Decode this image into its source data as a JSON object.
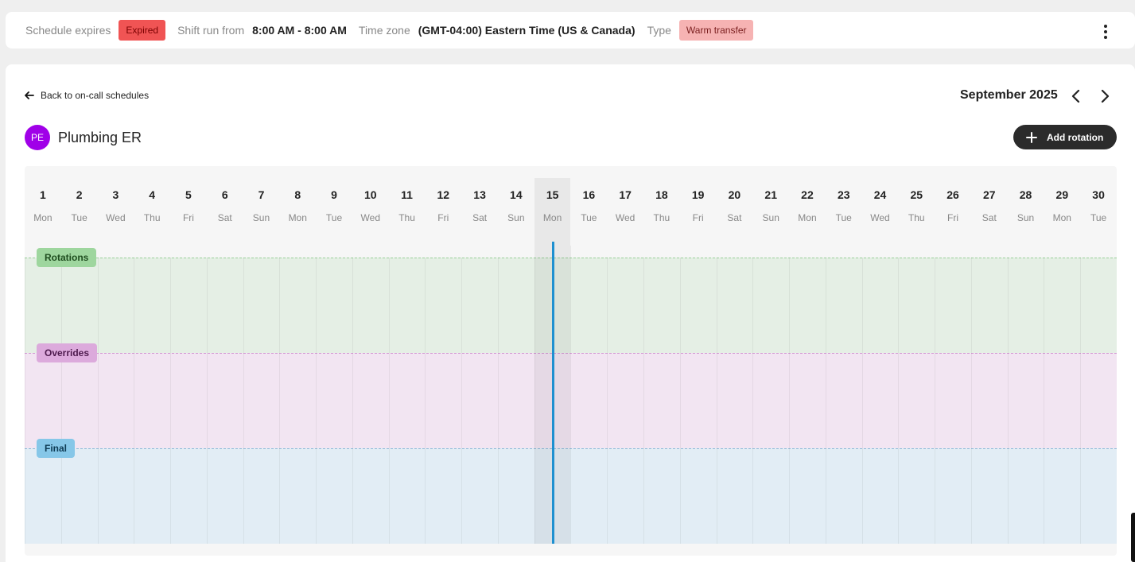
{
  "topbar": {
    "expires_label": "Schedule expires",
    "expires_badge": "Expired",
    "shift_label": "Shift run from",
    "shift_value": "8:00 AM - 8:00 AM",
    "tz_label": "Time zone",
    "tz_value": "(GMT-04:00) Eastern Time (US & Canada)",
    "type_label": "Type",
    "type_badge": "Warm transfer",
    "menu_icon": "more-vertical-icon"
  },
  "nav": {
    "back_label": "Back to on-call schedules",
    "month": "September 2025"
  },
  "schedule": {
    "initials": "PE",
    "name": "Plumbing ER",
    "add_rotation": "Add rotation"
  },
  "calendar": {
    "today_index": 14,
    "days": [
      {
        "n": "1",
        "wd": "Mon"
      },
      {
        "n": "2",
        "wd": "Tue"
      },
      {
        "n": "3",
        "wd": "Wed"
      },
      {
        "n": "4",
        "wd": "Thu"
      },
      {
        "n": "5",
        "wd": "Fri"
      },
      {
        "n": "6",
        "wd": "Sat"
      },
      {
        "n": "7",
        "wd": "Sun"
      },
      {
        "n": "8",
        "wd": "Mon"
      },
      {
        "n": "9",
        "wd": "Tue"
      },
      {
        "n": "10",
        "wd": "Wed"
      },
      {
        "n": "11",
        "wd": "Thu"
      },
      {
        "n": "12",
        "wd": "Fri"
      },
      {
        "n": "13",
        "wd": "Sat"
      },
      {
        "n": "14",
        "wd": "Sun"
      },
      {
        "n": "15",
        "wd": "Mon"
      },
      {
        "n": "16",
        "wd": "Tue"
      },
      {
        "n": "17",
        "wd": "Wed"
      },
      {
        "n": "18",
        "wd": "Thu"
      },
      {
        "n": "19",
        "wd": "Fri"
      },
      {
        "n": "20",
        "wd": "Sat"
      },
      {
        "n": "21",
        "wd": "Sun"
      },
      {
        "n": "22",
        "wd": "Mon"
      },
      {
        "n": "23",
        "wd": "Tue"
      },
      {
        "n": "24",
        "wd": "Wed"
      },
      {
        "n": "25",
        "wd": "Thu"
      },
      {
        "n": "26",
        "wd": "Fri"
      },
      {
        "n": "27",
        "wd": "Sat"
      },
      {
        "n": "28",
        "wd": "Sun"
      },
      {
        "n": "29",
        "wd": "Mon"
      },
      {
        "n": "30",
        "wd": "Tue"
      }
    ],
    "lanes": {
      "rotations": "Rotations",
      "overrides": "Overrides",
      "final": "Final"
    }
  },
  "colors": {
    "expired": "#f05454",
    "warm_transfer": "#f6b3b3",
    "avatar": "#a000e8",
    "rotations": "#9ed69e",
    "overrides": "#dcaadc",
    "final": "#86c7e8",
    "now_line": "#1e90d0"
  }
}
